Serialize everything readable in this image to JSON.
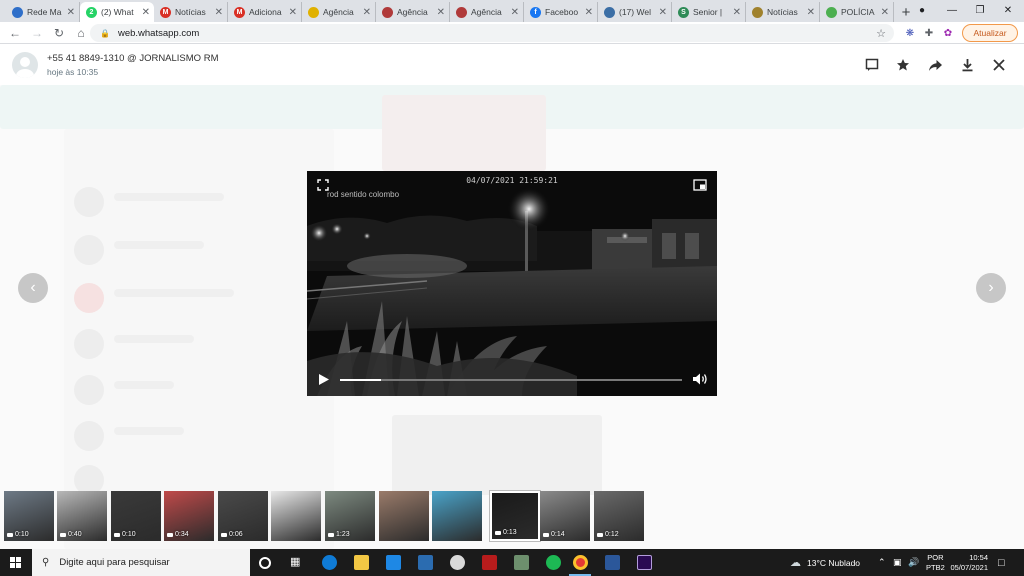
{
  "browser": {
    "tabs": [
      {
        "label": "Rede Ma",
        "color": "#2f6fc9",
        "glyph": "",
        "active": false
      },
      {
        "label": "(2) What",
        "color": "#25d366",
        "glyph": "2",
        "active": true
      },
      {
        "label": "Notícias",
        "color": "#d93025",
        "glyph": "M",
        "active": false
      },
      {
        "label": "Adiciona",
        "color": "#d93025",
        "glyph": "M",
        "active": false
      },
      {
        "label": "Agência",
        "color": "#e0b100",
        "glyph": "",
        "active": false
      },
      {
        "label": "Agência",
        "color": "#b03a3a",
        "glyph": "",
        "active": false
      },
      {
        "label": "Agência",
        "color": "#b03a3a",
        "glyph": "",
        "active": false
      },
      {
        "label": "Faceboo",
        "color": "#1877f2",
        "glyph": "f",
        "active": false
      },
      {
        "label": "(17) Wel",
        "color": "#3b6ea5",
        "glyph": "",
        "active": false
      },
      {
        "label": "Senior |",
        "color": "#2e8b57",
        "glyph": "S",
        "active": false
      },
      {
        "label": "Notícias",
        "color": "#a0822d",
        "glyph": "",
        "active": false
      },
      {
        "label": "POLÍCIA",
        "color": "#4caf50",
        "glyph": "",
        "active": false
      }
    ],
    "url": "web.whatsapp.com",
    "update_label": "Atualizar"
  },
  "viewer": {
    "sender": "+55 41 8849-1310 @ JORNALISMO RM",
    "time": "hoje às 10:35",
    "video": {
      "osd_timestamp": "04/07/2021 21:59:21",
      "osd_camera": "rod sentido colombo",
      "progress": 0.12
    },
    "thumbnails": [
      {
        "duration": "0:10",
        "tone": "#6e7a86",
        "active": false
      },
      {
        "duration": "0:40",
        "tone": "#b8b8b8",
        "active": false
      },
      {
        "duration": "0:10",
        "tone": "#3a3a3a",
        "active": false
      },
      {
        "duration": "0:34",
        "tone": "#c04a4a",
        "active": false
      },
      {
        "duration": "0:06",
        "tone": "#4a4a4a",
        "active": false
      },
      {
        "duration": "",
        "tone": "#e8e8e8",
        "active": false
      },
      {
        "duration": "1:23",
        "tone": "#7d8a80",
        "active": false
      },
      {
        "duration": "",
        "tone": "#9a7b6a",
        "active": false
      },
      {
        "duration": "",
        "tone": "#4aa3c9",
        "active": false
      },
      {
        "duration": "0:13",
        "tone": "#1a1a1a",
        "active": true
      },
      {
        "duration": "0:14",
        "tone": "#8a8a8a",
        "active": false
      },
      {
        "duration": "0:12",
        "tone": "#6a6a6a",
        "active": false
      }
    ]
  },
  "taskbar": {
    "search_placeholder": "Digite aqui para pesquisar",
    "weather": "13°C  Nublado",
    "lang_line1": "POR",
    "lang_line2": "PTB2",
    "clock_time": "10:54",
    "clock_date": "05/07/2021"
  }
}
